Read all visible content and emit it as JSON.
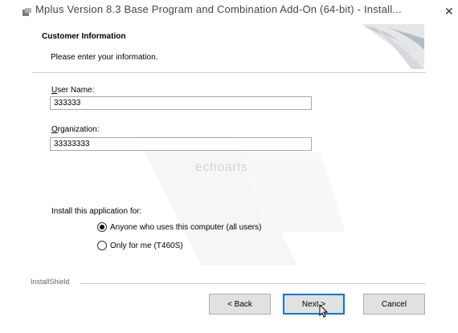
{
  "window": {
    "title": "Mplus Version 8.3 Base Program and Combination Add-On (64-bit) - Install...",
    "close_glyph": "✕"
  },
  "header": {
    "title": "Customer Information",
    "subtitle": "Please enter your information."
  },
  "form": {
    "user_name": {
      "label_accel": "U",
      "label_rest": "ser Name:",
      "value": "333333"
    },
    "organization": {
      "label_accel": "O",
      "label_rest": "rganization:",
      "value": "33333333"
    }
  },
  "watermark": "echoarts",
  "install_for": {
    "label": "Install this application for:",
    "options": [
      {
        "label": "Anyone who uses this computer (all users)",
        "checked": true
      },
      {
        "label": "Only for me (T460S)",
        "checked": false
      }
    ]
  },
  "footer": {
    "brand": "InstallShield",
    "back_label": "< Back",
    "next_label": "Next >",
    "cancel_label": "Cancel"
  },
  "colors": {
    "accent": "#0078d7",
    "button_face": "#e1e1e1"
  }
}
